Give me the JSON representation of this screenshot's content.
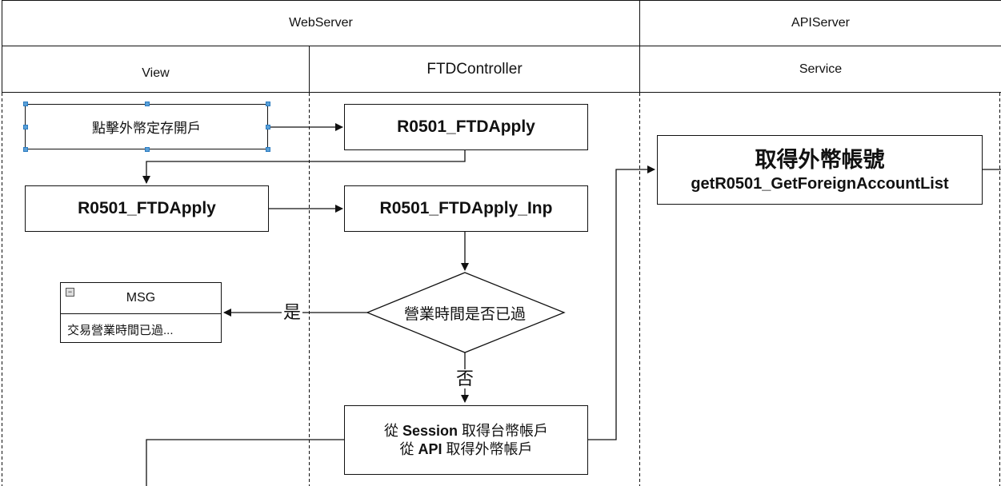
{
  "lanes": {
    "webserver": "WebServer",
    "apiserver": "APIServer",
    "view": "View",
    "ftdcontroller": "FTDController",
    "service": "Service"
  },
  "nodes": {
    "click_open": "點擊外幣定存開戶",
    "ftdapply_ctrl": "R0501_FTDApply",
    "ftdapply_view": "R0501_FTDApply",
    "ftdapply_inp": "R0501_FTDApply_Inp",
    "decision": "營業時間是否已過",
    "session_line1_a": "從 ",
    "session_line1_b": "Session",
    "session_line1_c": " 取得台幣帳戶",
    "session_line2_a": "從 ",
    "session_line2_b": "API",
    "session_line2_c": " 取得外幣帳戶",
    "get_account_title": "取得外幣帳號",
    "get_account_func": "getR0501_GetForeignAccountList"
  },
  "msg": {
    "title": "MSG",
    "body": "交易營業時間已過..."
  },
  "edge_labels": {
    "yes": "是",
    "no": "否"
  }
}
